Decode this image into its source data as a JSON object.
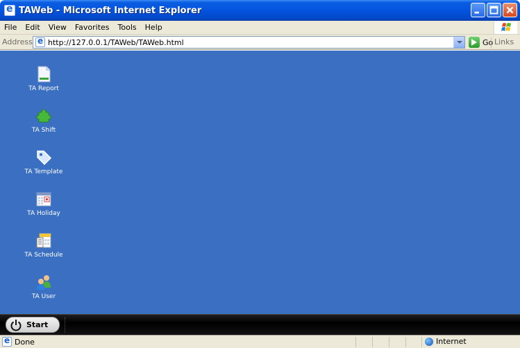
{
  "window": {
    "title": "TAWeb - Microsoft Internet Explorer"
  },
  "menu": {
    "items": [
      "File",
      "Edit",
      "View",
      "Favorites",
      "Tools",
      "Help"
    ]
  },
  "address": {
    "label": "Address",
    "url": "http://127.0.0.1/TAWeb/TAWeb.html",
    "go_label": "Go",
    "links_label": "Links"
  },
  "desktop": {
    "background": "#3a6fc1",
    "icons": [
      {
        "label": "TA Report",
        "icon": "document-icon"
      },
      {
        "label": "TA Shift",
        "icon": "puzzle-icon"
      },
      {
        "label": "TA Template",
        "icon": "tag-icon"
      },
      {
        "label": "TA Holiday",
        "icon": "calendar-icon"
      },
      {
        "label": "TA Schedule",
        "icon": "schedule-icon"
      },
      {
        "label": "TA User",
        "icon": "users-icon"
      }
    ]
  },
  "taskbar": {
    "start_label": "Start"
  },
  "status": {
    "text": "Done",
    "zone": "Internet"
  }
}
